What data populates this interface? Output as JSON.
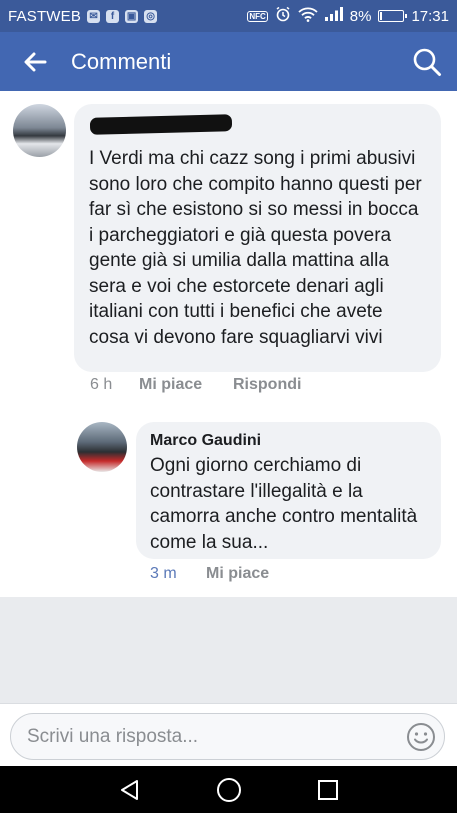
{
  "status_bar": {
    "carrier": "FASTWEB",
    "nfc": "NFC",
    "battery_percent": "8%",
    "battery_level": 0.08,
    "time": "17:31",
    "notification_icons": [
      "messenger-icon",
      "facebook-icon",
      "gallery-icon",
      "settings-app-icon"
    ]
  },
  "app_bar": {
    "title": "Commenti"
  },
  "comments": [
    {
      "author": "",
      "author_redacted": true,
      "text": "I Verdi ma chi cazz song i primi abusivi sono loro che compito hanno questi per far sì che esistono si so messi in bocca i parcheggiatori e già questa povera gente già si umilia dalla mattina alla sera e voi che estorcete denari agli italiani con tutti i benefici che avete cosa vi devono fare squagliarvi vivi",
      "time": "6 h",
      "like_label": "Mi piace",
      "reply_label": "Rispondi"
    },
    {
      "author": "Marco Gaudini",
      "text": "Ogni giorno cerchiamo di contrastare l'illegalità e la camorra anche contro mentalità come la sua...",
      "time": "3 m",
      "like_label": "Mi piace"
    }
  ],
  "composer": {
    "placeholder": "Scrivi una risposta..."
  },
  "colors": {
    "status_bar": "#3b5a9a",
    "app_bar": "#4267b2",
    "bubble": "#f0f2f5",
    "meta_text": "#8a8d91"
  }
}
